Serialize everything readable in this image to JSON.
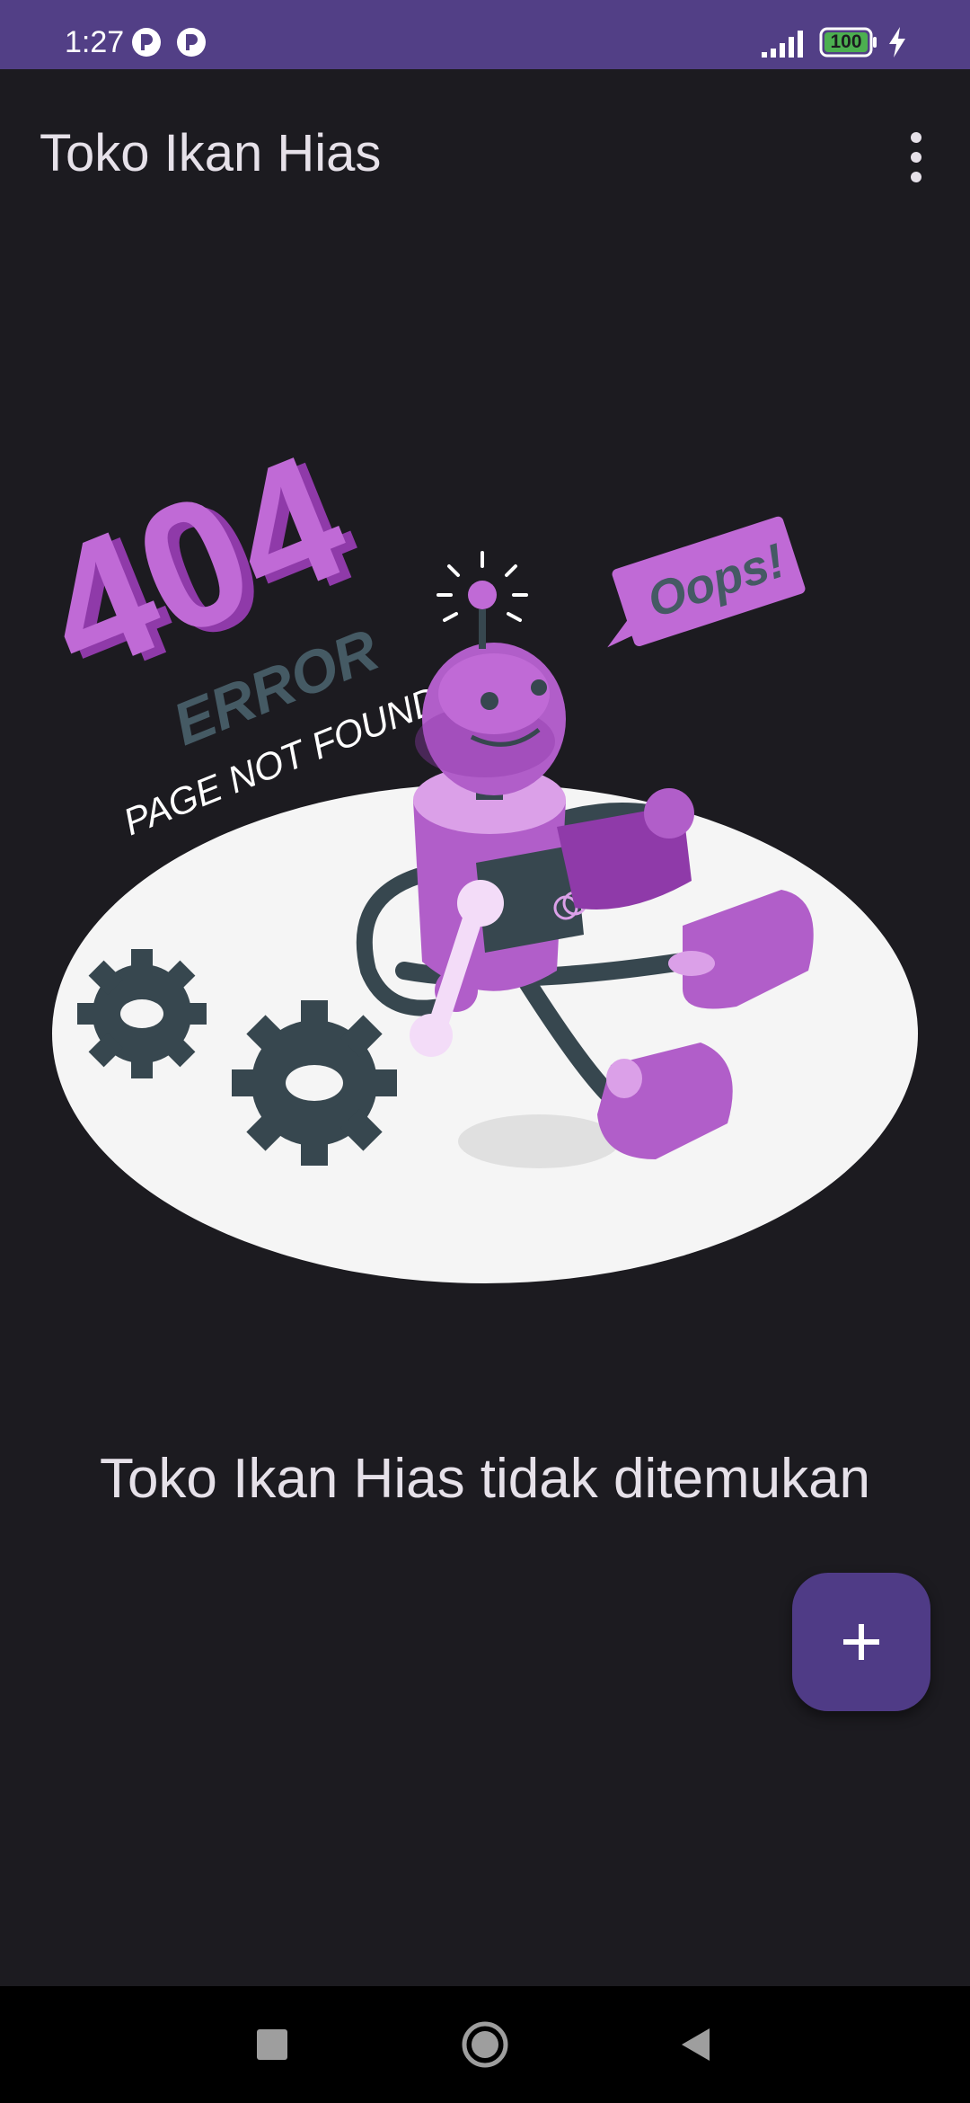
{
  "status_bar": {
    "time": "1:27",
    "battery_level": "100",
    "icons": [
      "app-notification-icon",
      "app-notification-icon",
      "signal-icon",
      "battery-icon",
      "charging-bolt-icon"
    ]
  },
  "app_bar": {
    "title": "Toko Ikan Hias",
    "menu_icon": "more-vertical-icon"
  },
  "illustration": {
    "big_text": "404",
    "error_text": "ERROR",
    "subtitle": "PAGE NOT FOUND",
    "bubble_text": "Oops!"
  },
  "empty_state": {
    "message": "Toko Ikan Hias tidak ditemukan"
  },
  "fab": {
    "icon": "add-icon"
  },
  "nav_bar": {
    "buttons": [
      "recent-apps-icon",
      "home-icon",
      "back-icon"
    ]
  },
  "colors": {
    "status_bar": "#523f86",
    "background": "#1c1b20",
    "fab": "#4f3b86",
    "text": "#e6e1e9",
    "accent_purple": "#b15ec9"
  }
}
